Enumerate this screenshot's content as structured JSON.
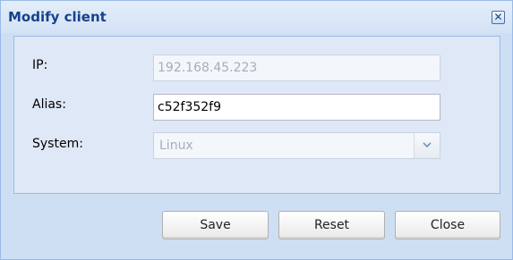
{
  "dialog": {
    "title": "Modify client",
    "close_tool": "✕"
  },
  "form": {
    "ip": {
      "label": "IP:",
      "value": "192.168.45.223",
      "disabled": true
    },
    "alias": {
      "label": "Alias:",
      "value": "c52f352f9",
      "disabled": false
    },
    "system": {
      "label": "System:",
      "selected": "Linux",
      "disabled": true
    }
  },
  "buttons": {
    "save_label": "Save",
    "reset_label": "Reset",
    "close_label": "Close"
  },
  "colors": {
    "title_text": "#15428b",
    "window_border": "#99bbe8",
    "panel_background": "#dfe8f6",
    "window_background": "#cfdff3"
  },
  "icons": {
    "close_tool": "close-icon",
    "combo_trigger": "chevron-down-icon"
  }
}
